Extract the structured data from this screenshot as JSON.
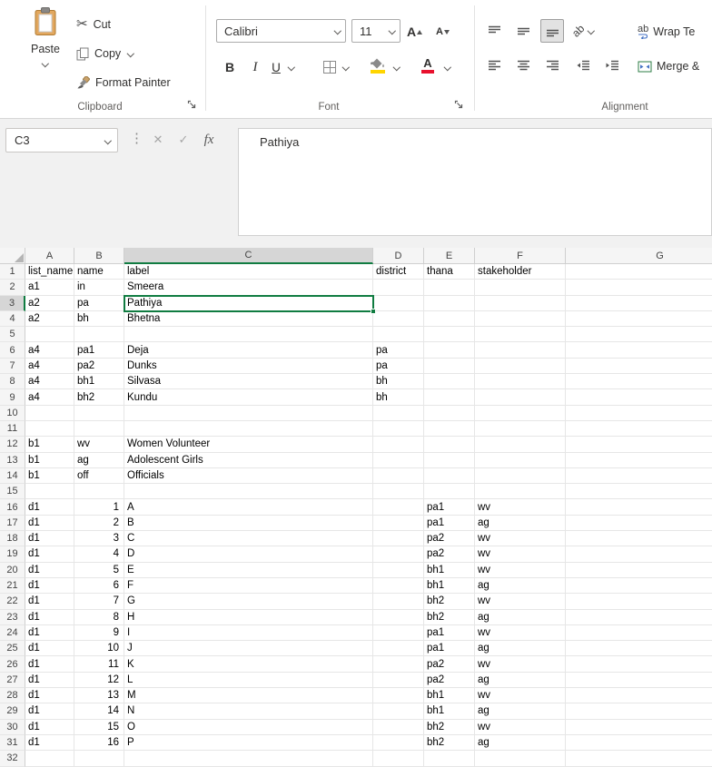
{
  "colors": {
    "selection_green": "#107c41",
    "fill_color_swatch": "#ffd500",
    "font_color_swatch": "#e8112d",
    "selected_header_bg": "#d6d6d6"
  },
  "icons": {
    "scissors": "✂",
    "vertical_dots": "⋮",
    "cancel_x": "✕",
    "enter_check": "✓",
    "fx": "fx",
    "ab": "ab",
    "letter_a": "A"
  },
  "ribbon": {
    "clipboard": {
      "group_label": "Clipboard",
      "paste": "Paste",
      "cut": "Cut",
      "copy": "Copy",
      "format_painter": "Format Painter"
    },
    "font": {
      "group_label": "Font",
      "font_name": "Calibri",
      "font_size": "11",
      "bold": "B",
      "italic": "I",
      "underline": "U"
    },
    "alignment": {
      "group_label": "Alignment",
      "wrap_text": "Wrap Te",
      "merge_center": "Merge &"
    }
  },
  "formula_bar": {
    "name_box": "C3",
    "content": "Pathiya"
  },
  "sheet": {
    "selected_cell": "C3",
    "selected_col": "C",
    "selected_row": 3,
    "columns": [
      "A",
      "B",
      "C",
      "D",
      "E",
      "F",
      "G"
    ],
    "rows": [
      [
        1,
        "list_name",
        "name",
        "label",
        "district",
        "thana",
        "stakeholder",
        ""
      ],
      [
        2,
        "a1",
        "in",
        "Smeera",
        "",
        "",
        "",
        ""
      ],
      [
        3,
        "a2",
        "pa",
        "Pathiya",
        "",
        "",
        "",
        ""
      ],
      [
        4,
        "a2",
        "bh",
        "Bhetna",
        "",
        "",
        "",
        ""
      ],
      [
        5,
        "",
        "",
        "",
        "",
        "",
        "",
        ""
      ],
      [
        6,
        "a4",
        "pa1",
        "Deja",
        "pa",
        "",
        "",
        ""
      ],
      [
        7,
        "a4",
        "pa2",
        "Dunks",
        "pa",
        "",
        "",
        ""
      ],
      [
        8,
        "a4",
        "bh1",
        "Silvasa",
        "bh",
        "",
        "",
        ""
      ],
      [
        9,
        "a4",
        "bh2",
        "Kundu",
        "bh",
        "",
        "",
        ""
      ],
      [
        10,
        "",
        "",
        "",
        "",
        "",
        "",
        ""
      ],
      [
        11,
        "",
        "",
        "",
        "",
        "",
        "",
        ""
      ],
      [
        12,
        "b1",
        "wv",
        "Women Volunteer",
        "",
        "",
        "",
        ""
      ],
      [
        13,
        "b1",
        "ag",
        "Adolescent Girls",
        "",
        "",
        "",
        ""
      ],
      [
        14,
        "b1",
        "off",
        "Officials",
        "",
        "",
        "",
        ""
      ],
      [
        15,
        "",
        "",
        "",
        "",
        "",
        "",
        ""
      ],
      [
        16,
        "d1",
        1,
        "A",
        "",
        "pa1",
        "wv",
        ""
      ],
      [
        17,
        "d1",
        2,
        "B",
        "",
        "pa1",
        "ag",
        ""
      ],
      [
        18,
        "d1",
        3,
        "C",
        "",
        "pa2",
        "wv",
        ""
      ],
      [
        19,
        "d1",
        4,
        "D",
        "",
        "pa2",
        "wv",
        ""
      ],
      [
        20,
        "d1",
        5,
        "E",
        "",
        "bh1",
        "wv",
        ""
      ],
      [
        21,
        "d1",
        6,
        "F",
        "",
        "bh1",
        "ag",
        ""
      ],
      [
        22,
        "d1",
        7,
        "G",
        "",
        "bh2",
        "wv",
        ""
      ],
      [
        23,
        "d1",
        8,
        "H",
        "",
        "bh2",
        "ag",
        ""
      ],
      [
        24,
        "d1",
        9,
        "I",
        "",
        "pa1",
        "wv",
        ""
      ],
      [
        25,
        "d1",
        10,
        "J",
        "",
        "pa1",
        "ag",
        ""
      ],
      [
        26,
        "d1",
        11,
        "K",
        "",
        "pa2",
        "wv",
        ""
      ],
      [
        27,
        "d1",
        12,
        "L",
        "",
        "pa2",
        "ag",
        ""
      ],
      [
        28,
        "d1",
        13,
        "M",
        "",
        "bh1",
        "wv",
        ""
      ],
      [
        29,
        "d1",
        14,
        "N",
        "",
        "bh1",
        "ag",
        ""
      ],
      [
        30,
        "d1",
        15,
        "O",
        "",
        "bh2",
        "wv",
        ""
      ],
      [
        31,
        "d1",
        16,
        "P",
        "",
        "bh2",
        "ag",
        ""
      ],
      [
        32,
        "",
        "",
        "",
        "",
        "",
        "",
        ""
      ]
    ]
  }
}
